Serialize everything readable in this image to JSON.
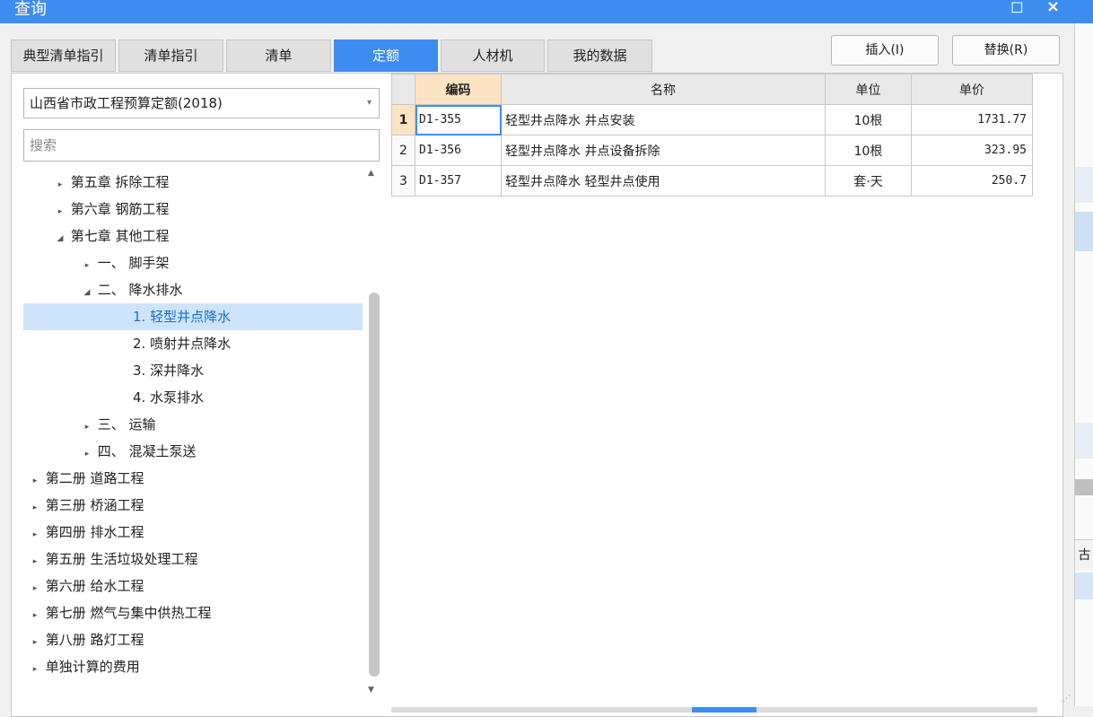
{
  "window": {
    "title": "查询",
    "restore_glyph": "◻",
    "close_glyph": "×"
  },
  "tabs": [
    {
      "label": "典型清单指引",
      "active": false
    },
    {
      "label": "清单指引",
      "active": false
    },
    {
      "label": "清单",
      "active": false
    },
    {
      "label": "定额",
      "active": true
    },
    {
      "label": "人材机",
      "active": false
    },
    {
      "label": "我的数据",
      "active": false
    }
  ],
  "toolbar": {
    "insert_label": "插入(I)",
    "replace_label": "替换(R)"
  },
  "library": {
    "selected": "山西省市政工程预算定额(2018)"
  },
  "search": {
    "placeholder": "搜索"
  },
  "tree": [
    {
      "label": "第五章 拆除工程",
      "toggle": "▸"
    },
    {
      "label": "第六章 钢筋工程",
      "toggle": "▸"
    },
    {
      "label": "第七章 其他工程",
      "toggle": "◢"
    },
    {
      "label": "一、 脚手架",
      "toggle": "▸"
    },
    {
      "label": "二、 降水排水",
      "toggle": "◢"
    },
    {
      "label": "1. 轻型井点降水",
      "toggle": "",
      "selected": true
    },
    {
      "label": "2. 喷射井点降水",
      "toggle": ""
    },
    {
      "label": "3. 深井降水",
      "toggle": ""
    },
    {
      "label": "4. 水泵排水",
      "toggle": ""
    },
    {
      "label": "三、 运输",
      "toggle": "▸"
    },
    {
      "label": "四、 混凝土泵送",
      "toggle": "▸"
    },
    {
      "label": "第二册 道路工程",
      "toggle": "▸"
    },
    {
      "label": "第三册 桥涵工程",
      "toggle": "▸"
    },
    {
      "label": "第四册 排水工程",
      "toggle": "▸"
    },
    {
      "label": "第五册 生活垃圾处理工程",
      "toggle": "▸"
    },
    {
      "label": "第六册 给水工程",
      "toggle": "▸"
    },
    {
      "label": "第七册 燃气与集中供热工程",
      "toggle": "▸"
    },
    {
      "label": "第八册 路灯工程",
      "toggle": "▸"
    },
    {
      "label": "单独计算的费用",
      "toggle": "▸"
    }
  ],
  "grid": {
    "columns": [
      "编码",
      "名称",
      "单位",
      "单价"
    ],
    "rows": [
      {
        "num": "1",
        "code": "D1-355",
        "name": "轻型井点降水 井点安装",
        "unit": "10根",
        "price": "1731.77"
      },
      {
        "num": "2",
        "code": "D1-356",
        "name": "轻型井点降水 井点设备拆除",
        "unit": "10根",
        "price": "323.95"
      },
      {
        "num": "3",
        "code": "D1-357",
        "name": "轻型井点降水 轻型井点使用",
        "unit": "套·天",
        "price": "250.7"
      }
    ]
  },
  "side_panel": {
    "text": "古"
  },
  "colors": {
    "accent": "#3d8df0",
    "selected_row": "#cde4fb",
    "header_highlight": "#fde3c4"
  }
}
